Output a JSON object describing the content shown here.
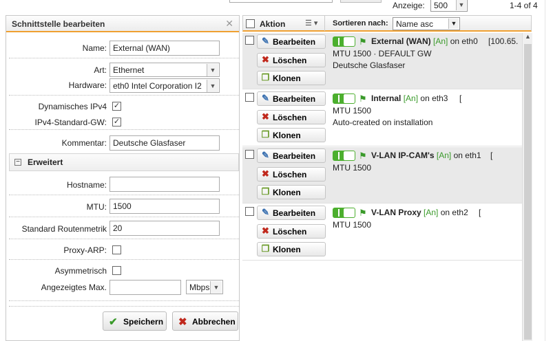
{
  "topbar": {
    "anzeige_label": "Anzeige:",
    "anzeige_value": "500",
    "count": "1-4 of 4"
  },
  "dialog": {
    "title": "Schnittstelle bearbeiten",
    "name_label": "Name:",
    "name_value": "External (WAN)",
    "art_label": "Art:",
    "art_value": "Ethernet",
    "hardware_label": "Hardware:",
    "hardware_value": "eth0 Intel Corporation I2",
    "dyn_ipv4_label": "Dynamisches IPv4",
    "ipv4_gw_label": "IPv4-Standard-GW:",
    "kommentar_label": "Kommentar:",
    "kommentar_value": "Deutsche Glasfaser",
    "section_label": "Erweitert",
    "hostname_label": "Hostname:",
    "hostname_value": "",
    "mtu_label": "MTU:",
    "mtu_value": "1500",
    "metric_label": "Standard Routenmetrik",
    "metric_value": "20",
    "proxyarp_label": "Proxy-ARP:",
    "asym_label": "Asymmetrisch",
    "maxshown_label": "Angezeigtes Max.",
    "maxshown_value": "",
    "unit_value": "Mbps",
    "save_label": "Speichern",
    "cancel_label": "Abbrechen"
  },
  "list": {
    "col_action": "Aktion",
    "sort_label": "Sortieren nach:",
    "sort_value": "Name asc",
    "edit_label": "Bearbeiten",
    "delete_label": "Löschen",
    "clone_label": "Klonen",
    "rows": [
      {
        "name": "External (WAN)",
        "state": "[An]",
        "on": "on eth0",
        "addr": "[100.65.",
        "line2": "MTU 1500 · DEFAULT GW",
        "line3": "Deutsche Glasfaser"
      },
      {
        "name": "Internal",
        "state": "[An]",
        "on": "on eth3",
        "addr": "[",
        "line2": "MTU 1500",
        "line3": "Auto-created on installation"
      },
      {
        "name": "V-LAN IP-CAM's",
        "state": "[An]",
        "on": "on eth1",
        "addr": "[",
        "line2": "MTU 1500",
        "line3": ""
      },
      {
        "name": "V-LAN Proxy",
        "state": "[An]",
        "on": "on eth2",
        "addr": "[",
        "line2": "MTU 1500",
        "line3": ""
      }
    ]
  },
  "colors": {
    "accent": "#f0a030",
    "switch_on": "#4caf2e",
    "state_green": "#3a9a2a",
    "delete_red": "#c0281c"
  }
}
